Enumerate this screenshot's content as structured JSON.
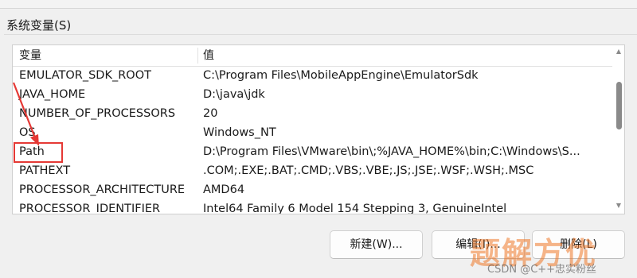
{
  "section_title": "系统变量(S)",
  "list": {
    "columns": [
      "变量",
      "值"
    ],
    "rows": [
      {
        "variable": "EMULATOR_SDK_ROOT",
        "value": "C:\\Program Files\\MobileAppEngine\\EmulatorSdk"
      },
      {
        "variable": "JAVA_HOME",
        "value": "D:\\java\\jdk"
      },
      {
        "variable": "NUMBER_OF_PROCESSORS",
        "value": "20"
      },
      {
        "variable": "OS",
        "value": "Windows_NT"
      },
      {
        "variable": "Path",
        "value": "D:\\Program Files\\VMware\\bin\\;%JAVA_HOME%\\bin;C:\\Windows\\S..."
      },
      {
        "variable": "PATHEXT",
        "value": ".COM;.EXE;.BAT;.CMD;.VBS;.VBE;.JS;.JSE;.WSF;.WSH;.MSC"
      },
      {
        "variable": "PROCESSOR_ARCHITECTURE",
        "value": "AMD64"
      },
      {
        "variable": "PROCESSOR_IDENTIFIER",
        "value": "Intel64 Family 6 Model 154 Stepping 3, GenuineIntel"
      }
    ]
  },
  "buttons": {
    "new": "新建(W)...",
    "edit": "编辑(I)...",
    "delete": "删除(L)"
  },
  "annotation": {
    "color": "#e53935",
    "highlighted_row": "Path"
  },
  "watermark": {
    "text": "题解方优",
    "credit": "CSDN @C++忠实粉丝"
  }
}
